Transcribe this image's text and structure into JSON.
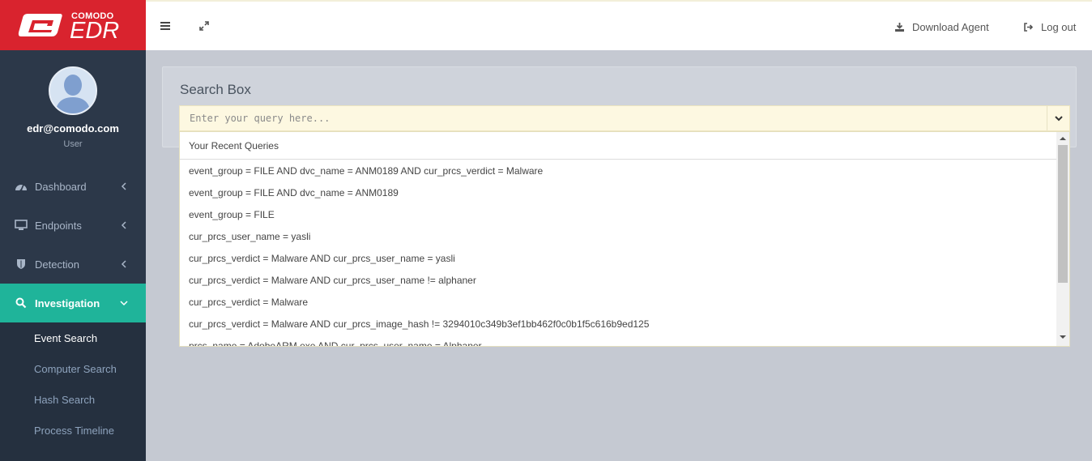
{
  "brand": {
    "company": "COMODO",
    "product": "EDR"
  },
  "user": {
    "email": "edr@comodo.com",
    "role": "User"
  },
  "nav": {
    "dashboard": "Dashboard",
    "endpoints": "Endpoints",
    "detection": "Detection",
    "investigation": "Investigation",
    "sub": {
      "event_search": "Event Search",
      "computer_search": "Computer Search",
      "hash_search": "Hash Search",
      "process_timeline": "Process Timeline"
    }
  },
  "topbar": {
    "download_agent": "Download Agent",
    "log_out": "Log out"
  },
  "search": {
    "title": "Search Box",
    "placeholder": "Enter your query here...",
    "recent_header": "Your Recent Queries",
    "queries": [
      "event_group = FILE AND dvc_name = ANM0189 AND cur_prcs_verdict = Malware",
      "event_group = FILE AND dvc_name = ANM0189",
      "event_group = FILE",
      "cur_prcs_user_name = yasli",
      "cur_prcs_verdict = Malware AND cur_prcs_user_name = yasli",
      "cur_prcs_verdict = Malware AND cur_prcs_user_name != alphaner",
      "cur_prcs_verdict = Malware",
      "cur_prcs_verdict = Malware AND cur_prcs_image_hash != 3294010c349b3ef1bb462f0c0b1f5c616b9ed125",
      "prcs_name = AdobeARM.exe AND cur_prcs_user_name = Alphaner"
    ]
  },
  "colors": {
    "brand_red": "#d9232e",
    "sidebar": "#2c3849",
    "active_teal": "#1fb49a"
  },
  "icons": [
    "dashboard-icon",
    "monitor-icon",
    "shield-icon",
    "search-icon",
    "menu-icon",
    "expand-icon",
    "download-icon",
    "logout-icon",
    "chevron-down-icon"
  ]
}
